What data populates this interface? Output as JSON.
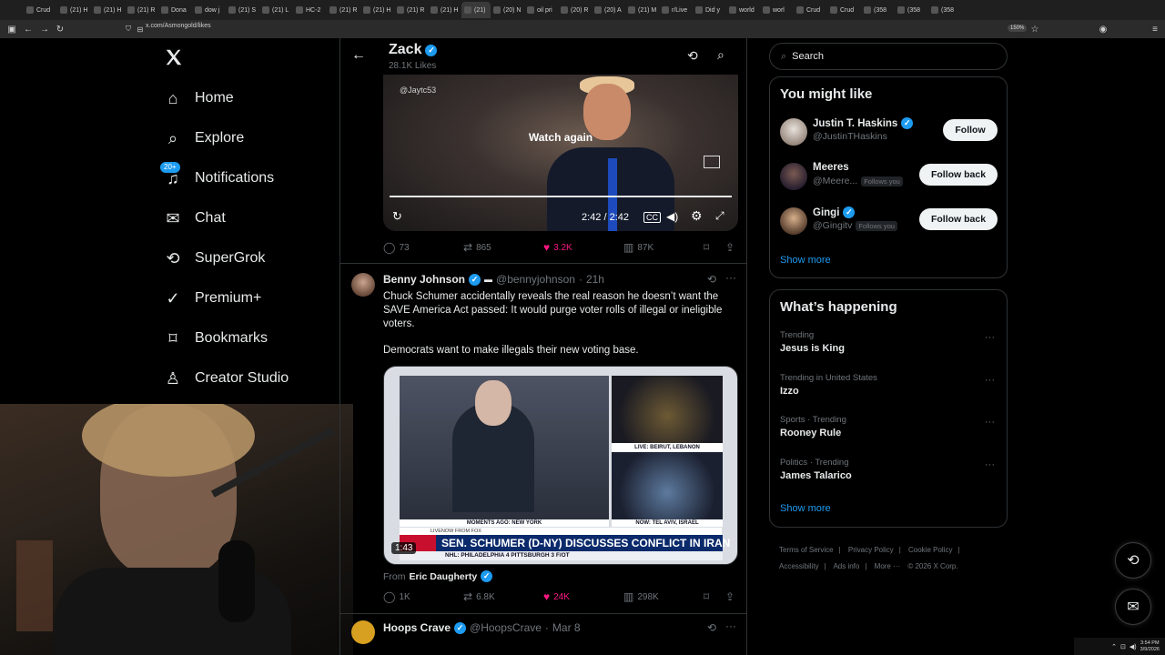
{
  "browser": {
    "tabs": [
      {
        "label": "Crud"
      },
      {
        "label": "(21) H"
      },
      {
        "label": "(21) H"
      },
      {
        "label": "(21) R"
      },
      {
        "label": "Dona"
      },
      {
        "label": "dow j"
      },
      {
        "label": "(21) S"
      },
      {
        "label": "(21) L"
      },
      {
        "label": "HC-2"
      },
      {
        "label": "(21) R"
      },
      {
        "label": "(21) H"
      },
      {
        "label": "(21) R"
      },
      {
        "label": "(21) H"
      },
      {
        "label": "(21)"
      },
      {
        "label": "(20) N"
      },
      {
        "label": "oil pri"
      },
      {
        "label": "(20) R"
      },
      {
        "label": "(20) A"
      },
      {
        "label": "(21) M"
      },
      {
        "label": "r/Live"
      },
      {
        "label": "Did y"
      },
      {
        "label": "world"
      },
      {
        "label": "worl"
      },
      {
        "label": "Crud"
      },
      {
        "label": "Crud"
      },
      {
        "label": "(358"
      },
      {
        "label": "(358"
      },
      {
        "label": "(358"
      }
    ],
    "url": "x.com/Asmongold/likes",
    "zoom": "150%"
  },
  "nav": {
    "items": [
      {
        "label": "Home",
        "icon": "home-icon"
      },
      {
        "label": "Explore",
        "icon": "search-icon"
      },
      {
        "label": "Notifications",
        "icon": "bell-icon",
        "badge": "20+"
      },
      {
        "label": "Chat",
        "icon": "mail-icon"
      },
      {
        "label": "SuperGrok",
        "icon": "grok-icon"
      },
      {
        "label": "Premium+",
        "icon": "premium-icon"
      },
      {
        "label": "Bookmarks",
        "icon": "bookmark-icon"
      },
      {
        "label": "Creator Studio",
        "icon": "creator-studio-icon"
      }
    ]
  },
  "header": {
    "name": "Zack",
    "likes": "28.1K Likes"
  },
  "tweet1": {
    "watermark": "@Jaytc53",
    "overlay": "Watch again",
    "time": "2:42 / 2:42",
    "replies": "73",
    "reposts": "865",
    "likes": "3.2K",
    "views": "87K"
  },
  "tweet2": {
    "name": "Benny Johnson",
    "handle": "@bennyjohnson",
    "age": "21h",
    "text1": "Chuck Schumer accidentally reveals the real reason he doesn’t want the SAVE America Act passed: It would purge voter rolls of illegal or ineligible voters.",
    "text2": "Democrats want to make illegals their new voting base.",
    "video": {
      "duration": "1:43",
      "caption_left": "MOMENTS AGO: NEW YORK",
      "caption_r1": "LIVE: BEIRUT, LEBANON",
      "caption_r2": "NOW: TEL AVIV, ISRAEL",
      "chyron_top": "LIVENOW FROM FOX",
      "chyron": "SEN. SCHUMER (D-NY) DISCUSSES CONFLICT IN IRAN",
      "ticker": "NHL: PHILADELPHIA 4  PITTSBURGH 3  F/OT"
    },
    "from_label": "From",
    "from_name": "Eric Daugherty",
    "replies": "1K",
    "reposts": "6.8K",
    "likes": "24K",
    "views": "298K"
  },
  "tweet3": {
    "name": "Hoops Crave",
    "handle": "@HoopsCrave",
    "age": "Mar 8"
  },
  "right": {
    "search_placeholder": "Search",
    "wtf_title": "You might like",
    "wtf": [
      {
        "name": "Justin T. Haskins",
        "handle": "@JustinTHaskins",
        "verified": true,
        "follows_you": "",
        "button": "Follow"
      },
      {
        "name": "Meeres",
        "handle": "@Meere...",
        "verified": false,
        "follows_you": "Follows you",
        "button": "Follow back"
      },
      {
        "name": "Gingi",
        "handle": "@Gingitv",
        "verified": true,
        "follows_you": "Follows you",
        "button": "Follow back"
      }
    ],
    "show_more": "Show more",
    "trending_title": "What’s happening",
    "trends": [
      {
        "context": "Trending",
        "name": "Jesus is King"
      },
      {
        "context": "Trending in United States",
        "name": "Izzo"
      },
      {
        "context": "Sports · Trending",
        "name": "Rooney Rule"
      },
      {
        "context": "Politics · Trending",
        "name": "James Talarico"
      }
    ],
    "show_more_2": "Show more",
    "footer": {
      "terms": "Terms of Service",
      "privacy": "Privacy Policy",
      "cookie": "Cookie Policy",
      "accessibility": "Accessibility",
      "ads": "Ads info",
      "more": "More ···",
      "copyright": "© 2026 X Corp."
    }
  },
  "taskbar": {
    "time": "3:54 PM",
    "date": "3/9/2026"
  },
  "colors": {
    "accent": "#1d9bf0",
    "like": "#f91880",
    "muted": "#71767b",
    "border": "#2f3336"
  }
}
